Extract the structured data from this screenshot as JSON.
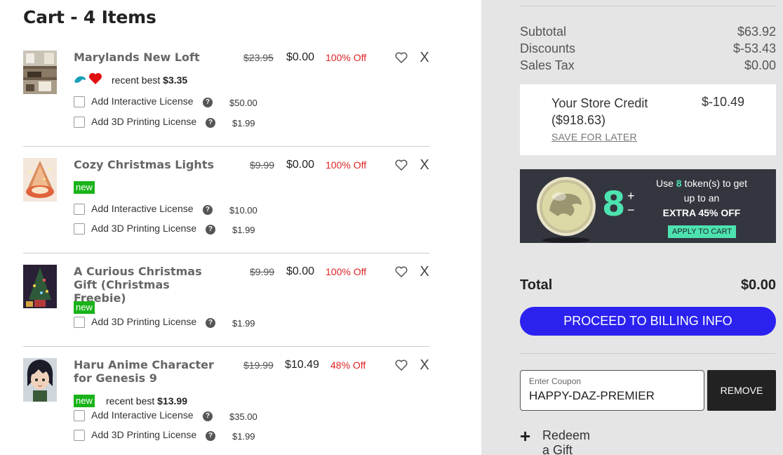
{
  "cart": {
    "title": "Cart - 4 Items",
    "items": [
      {
        "name": "Marylands New Loft",
        "original_price": "$23.95",
        "price": "$0.00",
        "discount": "100% Off",
        "best_label": "recent best",
        "best_price": "$3.35",
        "addons": [
          {
            "label": "Add Interactive License",
            "price": "$50.00"
          },
          {
            "label": "Add 3D Printing License",
            "price": "$1.99"
          }
        ]
      },
      {
        "name": "Cozy Christmas Lights",
        "original_price": "$9.99",
        "price": "$0.00",
        "discount": "100% Off",
        "badge": "new",
        "addons": [
          {
            "label": "Add Interactive License",
            "price": "$10.00"
          },
          {
            "label": "Add 3D Printing License",
            "price": "$1.99"
          }
        ]
      },
      {
        "name": "A Curious Christmas Gift (Christmas Freebie)",
        "original_price": "$9.99",
        "price": "$0.00",
        "discount": "100% Off",
        "badge": "new",
        "addons": [
          {
            "label": "Add 3D Printing License",
            "price": "$1.99"
          }
        ]
      },
      {
        "name": "Haru Anime Character for Genesis 9",
        "original_price": "$19.99",
        "price": "$10.49",
        "discount": "48% Off",
        "badge": "new",
        "best_label": "recent best",
        "best_price": "$13.99",
        "addons": [
          {
            "label": "Add Interactive License",
            "price": "$35.00"
          },
          {
            "label": "Add 3D Printing License",
            "price": "$1.99"
          }
        ]
      }
    ],
    "remove_glyph": "X"
  },
  "summary": {
    "subtotal_label": "Subtotal",
    "subtotal": "$63.92",
    "discounts_label": "Discounts",
    "discounts": "$-53.43",
    "tax_label": "Sales Tax",
    "tax": "$0.00",
    "credit_label": "Your Store Credit ($918.63)",
    "credit_value": "$-10.49",
    "save_later": "SAVE FOR LATER",
    "token": {
      "count": "8",
      "plus": "+",
      "minus": "−",
      "line1_pre": "Use",
      "line1_num": "8",
      "line1_post": "token(s) to get up to an",
      "line2": "EXTRA 45% OFF",
      "apply": "APPLY TO CART"
    },
    "total_label": "Total",
    "total": "$0.00",
    "proceed": "PROCEED TO BILLING INFO",
    "coupon_label": "Enter Coupon",
    "coupon_value": "HAPPY-DAZ-PREMIER",
    "remove": "REMOVE",
    "gift_plus": "+",
    "gift_label": "Redeem a Gift Card"
  },
  "colors": {
    "proceed": "#2b22f0",
    "discount": "#dd2222",
    "badge_new": "#19b319",
    "token_accent": "#4de3b0",
    "token_panel": "#34363f",
    "sidebar_bg": "#e5e5e5"
  },
  "icons": [
    "heart-outline-icon",
    "close-icon",
    "help-icon",
    "plus-icon",
    "dolphin-icon",
    "heart-filled-icon",
    "token-coin-icon"
  ]
}
